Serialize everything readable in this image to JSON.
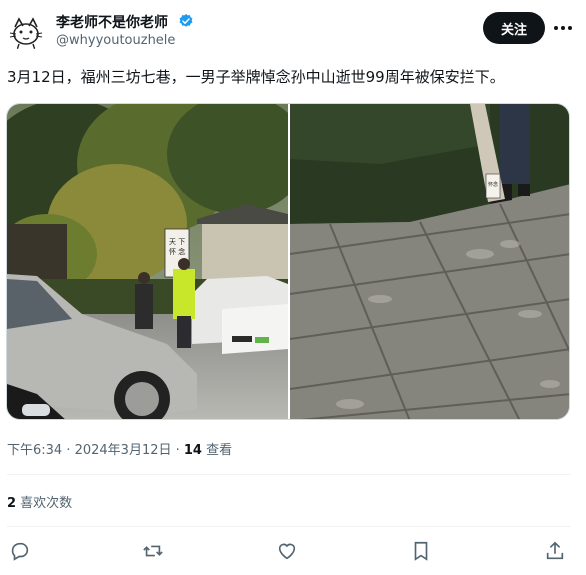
{
  "author": {
    "name": "李老师不是你老师",
    "handle": "@whyyoutouzhele",
    "verified": true
  },
  "header": {
    "follow_label": "关注"
  },
  "tweet": {
    "text": "3月12日，福州三坊七巷，一男子举牌悼念孙中山逝世99周年被保安拦下。",
    "sign_text_left": "天下为公",
    "sign_text_right": "怀念孙中山",
    "sign_text_photo2": "怀念孙"
  },
  "meta": {
    "time": "下午6:34 · 2024年3月12日 · ",
    "views_count": "14",
    "views_label": " 查看"
  },
  "engagement": {
    "likes_count": "2",
    "likes_label": " 喜欢次数"
  },
  "icons": {
    "reply": "reply-icon",
    "retweet": "retweet-icon",
    "like": "heart-icon",
    "bookmark": "bookmark-icon",
    "share": "share-icon"
  },
  "colors": {
    "verified": "#1d9bf0",
    "text_primary": "#0f1419",
    "text_secondary": "#536471",
    "follow_bg": "#0f1419"
  }
}
